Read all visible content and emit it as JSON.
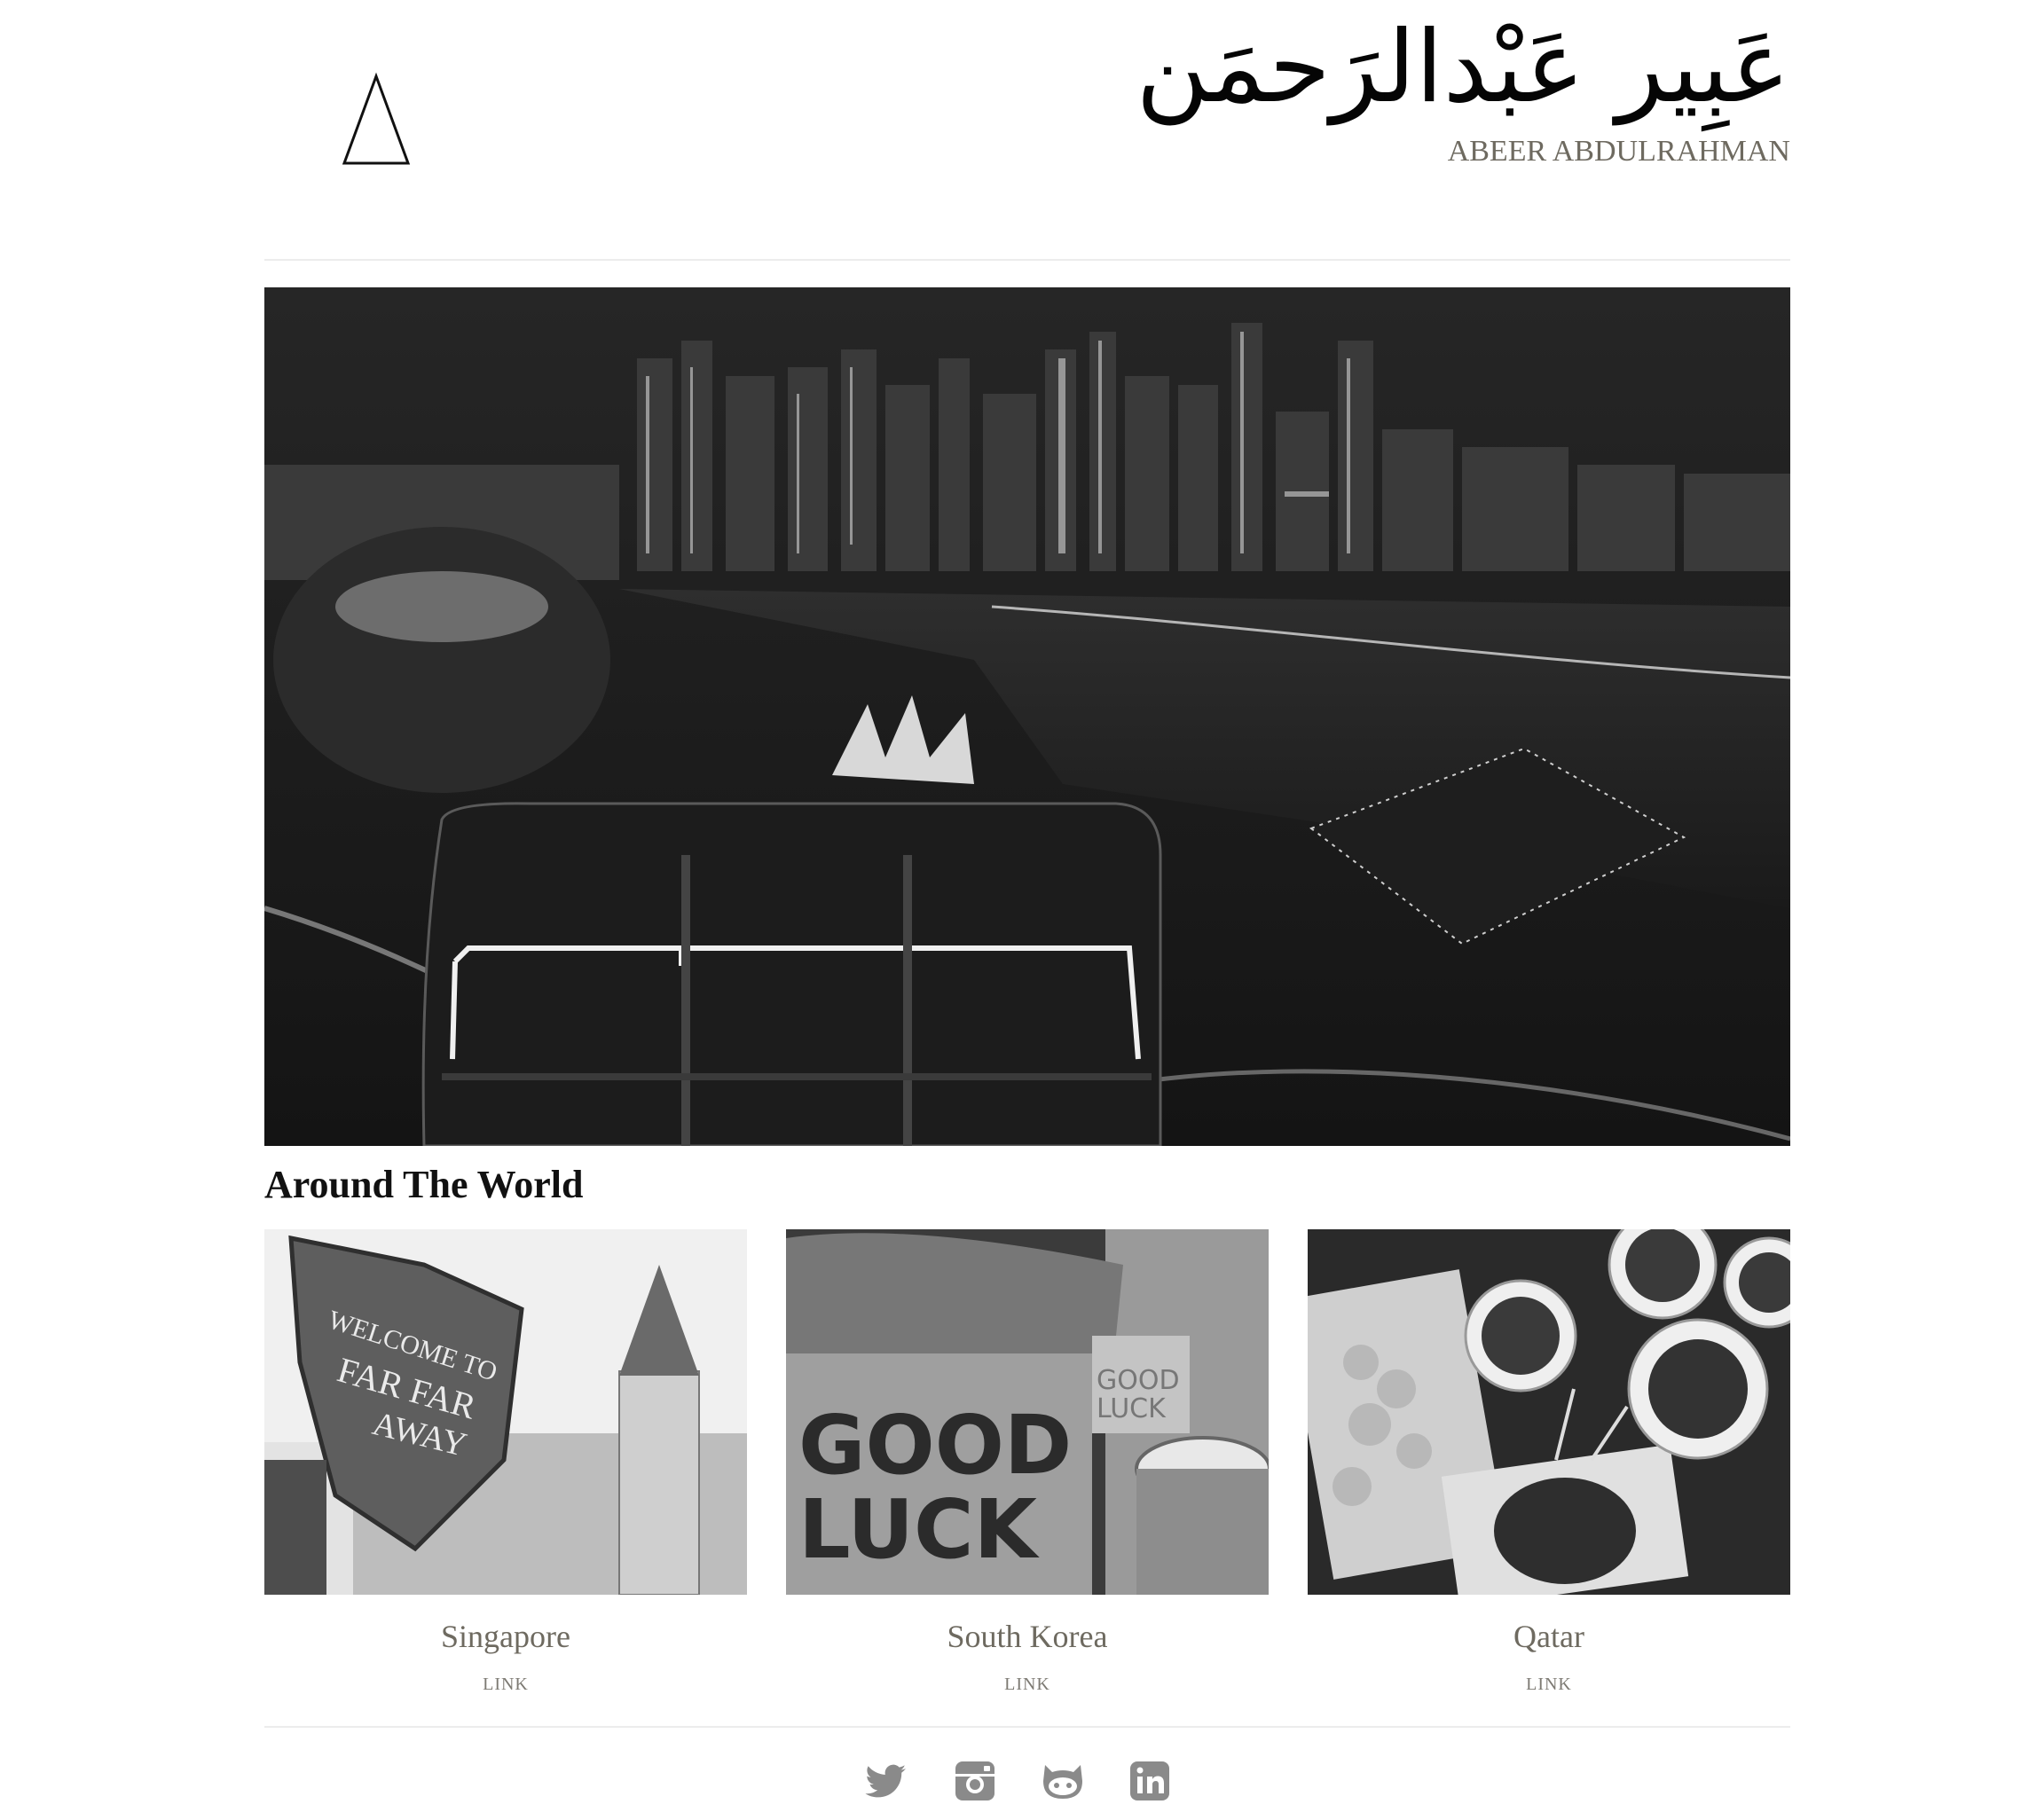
{
  "header": {
    "arabic_name": "عَبِير عَبْدالرَحمَن",
    "latin_name": "ABEER ABDULRAHMAN",
    "logo_icon": "delta-triangle-icon"
  },
  "hero": {
    "image": "singapore-night-skyline-photo"
  },
  "section": {
    "title": "Around The World"
  },
  "cards": [
    {
      "caption": "Singapore",
      "link_label": "LINK",
      "image": "far-far-away-sign-photo"
    },
    {
      "caption": "South Korea",
      "link_label": "LINK",
      "image": "good-luck-toast-photo"
    },
    {
      "caption": "Qatar",
      "link_label": "LINK",
      "image": "food-tray-photo"
    }
  ],
  "social": [
    {
      "icon": "twitter-icon"
    },
    {
      "icon": "instagram-icon"
    },
    {
      "icon": "github-icon"
    },
    {
      "icon": "linkedin-icon"
    }
  ],
  "colors": {
    "caption_gray": "#6e6a60",
    "rule": "#ececec",
    "icon_gray": "#8a8a8a"
  }
}
